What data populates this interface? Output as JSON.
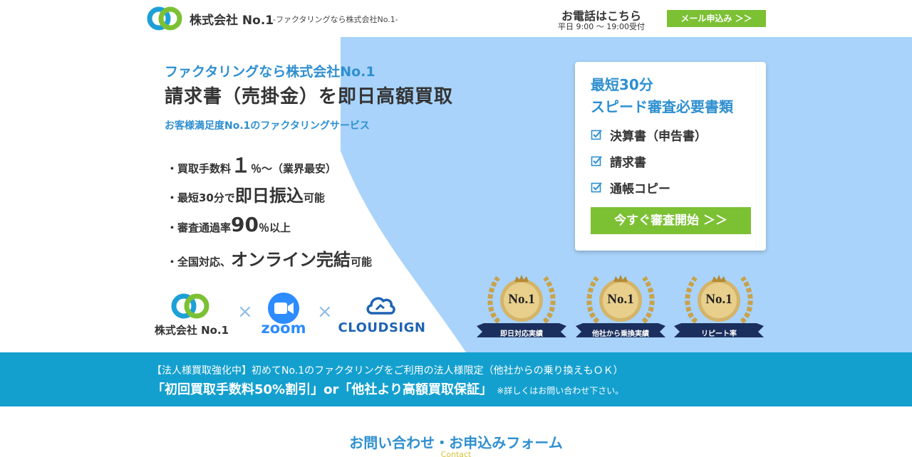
{
  "header": {
    "company": "株式会社 No.1",
    "tagline": "-ファクタリングなら株式会社No.1-",
    "tel_title": "お電話はこちら",
    "tel_hours": "平日 9:00 〜 19:00受付",
    "mail_button": "メール申込み ＞＞"
  },
  "hero": {
    "eyebrow": "ファクタリングなら株式会社No.1",
    "title": "請求書（売掛金）を即日高額買取",
    "lead": "お客様満足度No.1のファクタリングサービス",
    "points": [
      {
        "pre": "・買取手数料",
        "big": "１",
        "post": "％〜（業界最安）"
      },
      {
        "pre": "・最短30分で",
        "big": "即日振込",
        "post": "可能"
      },
      {
        "pre": "・審査通過率",
        "big": "90",
        "post": "％以上"
      },
      {
        "pre": "・全国対応、",
        "big": "オンライン完結",
        "post": "可能"
      }
    ]
  },
  "card": {
    "heading_1": "最短30分",
    "heading_2": "スピード審査必要書類",
    "documents": [
      "決算書（申告書）",
      "請求書",
      "通帳コピー"
    ],
    "start_button": "今すぐ審査開始 ＞＞"
  },
  "partners": {
    "company": "株式会社 No.1",
    "times": "×",
    "zoom": "zoom",
    "cloudsign": "CLOUDSIGN"
  },
  "badges": {
    "mark": "No.1",
    "labels": [
      "即日対応実績",
      "他社から乗換実績",
      "リピート率"
    ]
  },
  "campaign": {
    "line_1": "【法人様買取強化中】初めてNo.1のファクタリングをご利用の法人様限定（他社からの乗り換えもＯＫ）",
    "line_2": "「初回買取手数料50%割引」or「他社より高額買取保証」",
    "note": "※詳しくはお問い合わせ下さい。"
  },
  "form": {
    "title": "お問い合わせ・お申込みフォーム",
    "subtitle": "Contact"
  },
  "colors": {
    "accent_blue": "#2e8fd0",
    "green": "#7cc034",
    "band": "#14a0cf",
    "hero_bg": "#a9d3fa"
  },
  "icons": [
    "logo-rings-icon",
    "check-icon",
    "zoom-camera-icon",
    "cloudsign-cloud-icon",
    "crown-icon",
    "laurel-icon"
  ]
}
